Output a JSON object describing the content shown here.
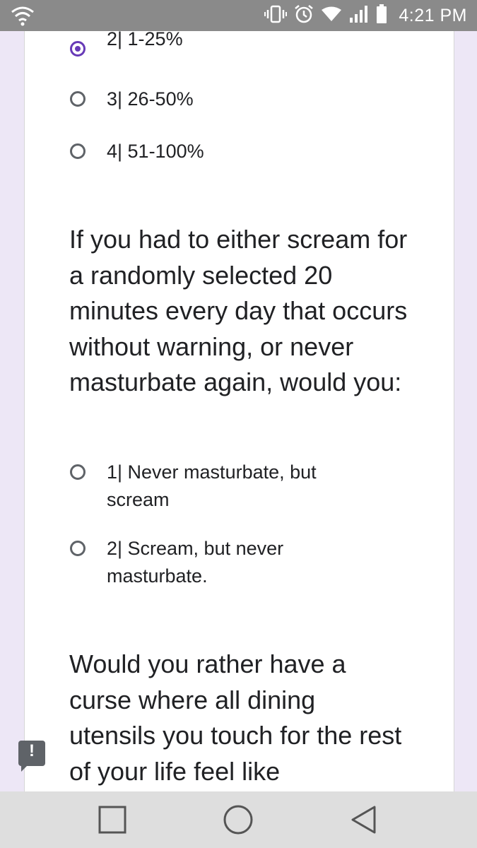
{
  "status_bar": {
    "time": "4:21 PM",
    "icons": [
      "wifi-call-icon",
      "vibrate-icon",
      "alarm-icon",
      "wifi-icon",
      "signal-icon",
      "battery-icon"
    ]
  },
  "form": {
    "q1_options": [
      {
        "label": "2| 1-25%",
        "selected": true
      },
      {
        "label": "3| 26-50%",
        "selected": false
      },
      {
        "label": "4| 51-100%",
        "selected": false
      }
    ],
    "q2": {
      "text": "If you had to either scream for a randomly selected 20 minutes every day that occurs without warning, or never masturbate again, would you:",
      "options": [
        {
          "label": "1| Never masturbate, but scream",
          "selected": false
        },
        {
          "label": "2| Scream, but never masturbate.",
          "selected": false
        }
      ]
    },
    "q3": {
      "text": "Would you rather have a curse where all dining utensils you touch for the rest of your life feel like"
    },
    "accent_color": "#673ab7"
  },
  "feedback_button": {
    "label": "!"
  },
  "nav_bar": {
    "buttons": [
      "recents-square-icon",
      "home-circle-icon",
      "back-triangle-icon"
    ]
  }
}
